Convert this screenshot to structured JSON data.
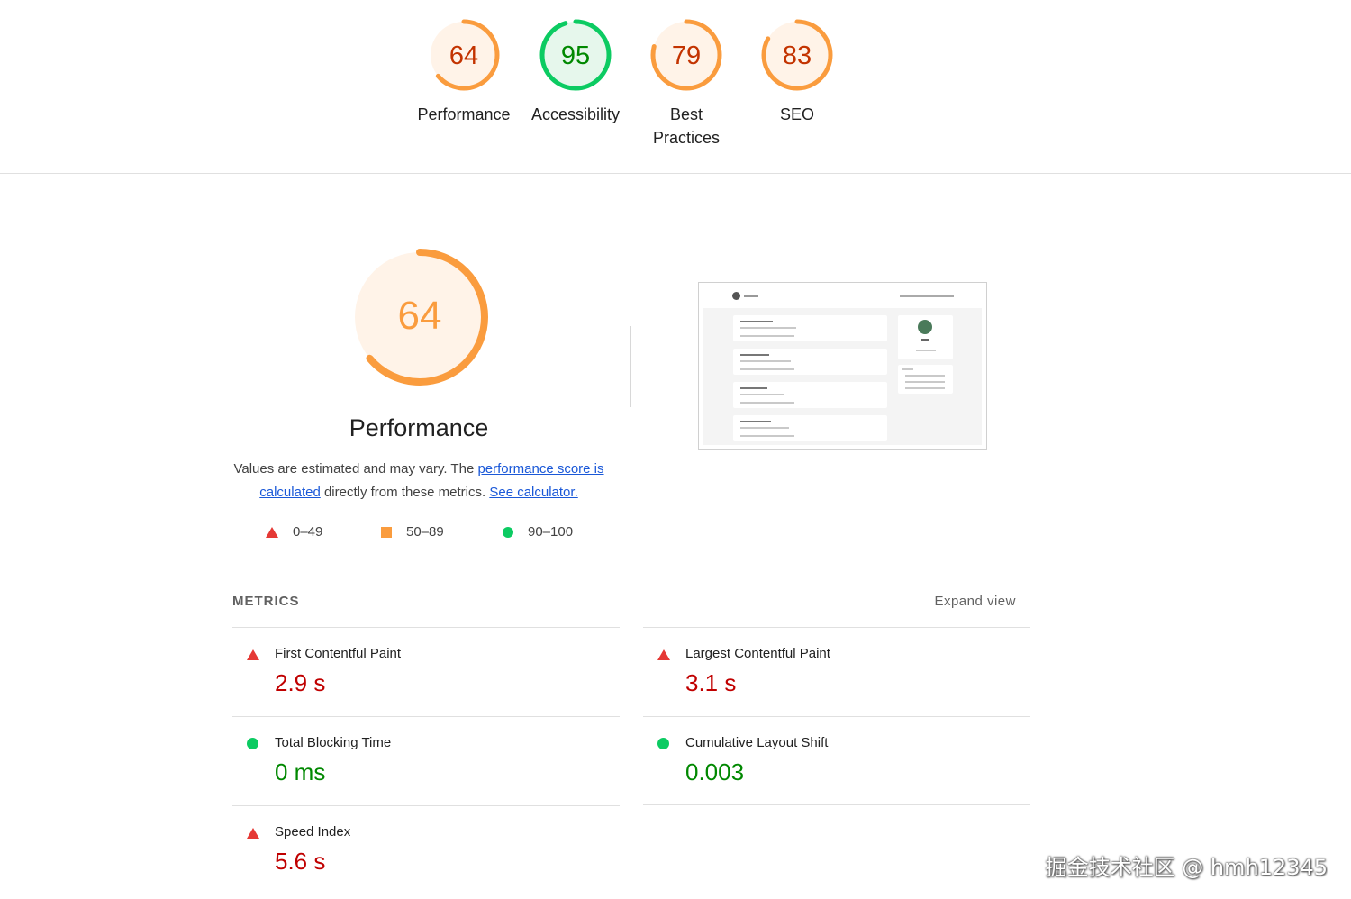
{
  "gauges": [
    {
      "score": "64",
      "label": "Performance",
      "value": 0.64,
      "color": "#fa9c3e",
      "text_color": "#c33300",
      "bg": "#fff3e8"
    },
    {
      "score": "95",
      "label": "Accessibility",
      "value": 0.95,
      "color": "#0ccb62",
      "text_color": "#008800",
      "bg": "#e6f7ec"
    },
    {
      "score": "79",
      "label": "Best Practices",
      "value": 0.79,
      "color": "#fa9c3e",
      "text_color": "#c33300",
      "bg": "#fff3e8"
    },
    {
      "score": "83",
      "label": "SEO",
      "value": 0.83,
      "color": "#fa9c3e",
      "text_color": "#c33300",
      "bg": "#fff3e8"
    }
  ],
  "performance": {
    "score": "64",
    "value": 0.64,
    "title": "Performance",
    "desc_prefix": "Values are estimated and may vary. The ",
    "link_score": "performance score is calculated",
    "desc_middle": " directly from these metrics. ",
    "link_calculator": "See calculator.",
    "legend": [
      {
        "range": "0–49",
        "shape": "triangle",
        "color": "#e53935"
      },
      {
        "range": "50–89",
        "shape": "square",
        "color": "#fa9c3e"
      },
      {
        "range": "90–100",
        "shape": "circle",
        "color": "#0ccb62"
      }
    ]
  },
  "metrics": {
    "header": "METRICS",
    "expand_label": "Expand view",
    "items": [
      {
        "label": "First Contentful Paint",
        "value": "2.9 s",
        "status": "fail"
      },
      {
        "label": "Largest Contentful Paint",
        "value": "3.1 s",
        "status": "fail"
      },
      {
        "label": "Total Blocking Time",
        "value": "0 ms",
        "status": "pass"
      },
      {
        "label": "Cumulative Layout Shift",
        "value": "0.003",
        "status": "pass"
      },
      {
        "label": "Speed Index",
        "value": "5.6 s",
        "status": "fail"
      }
    ]
  },
  "watermark": "掘金技术社区 @ hmh12345"
}
